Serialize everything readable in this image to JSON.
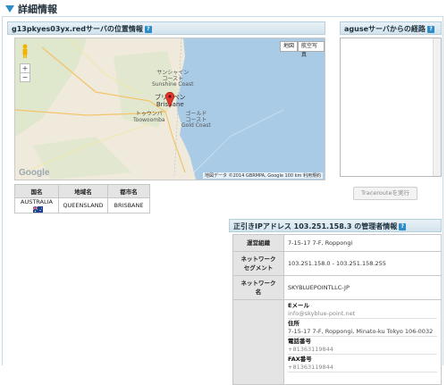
{
  "section": {
    "title": "詳細情報"
  },
  "location": {
    "panel_title": "g13pkyes03yx.redサーバの位置情報",
    "help": "?",
    "map": {
      "btn_map": "地図",
      "btn_sat": "航空写真",
      "zoom_in": "+",
      "zoom_out": "−",
      "google": "Google",
      "attribution": "地図データ ©2014 GBRMPA, Google  100 km  利用規約",
      "labels": {
        "sunshine_jp": "サンシャイン",
        "coast_jp": "コースト",
        "sunshine_en": "Sunshine Coast",
        "brisbane_jp": "ブリスベン",
        "brisbane_en": "Brisbane",
        "toowoomba_jp": "トゥウンバ",
        "toowoomba_en": "Toowoomba",
        "gold_jp": "ゴールド",
        "gold_coast_jp": "コースト",
        "gold_en": "Gold Coast"
      }
    },
    "table": {
      "headers": {
        "country": "国名",
        "region": "地域名",
        "city": "都市名"
      },
      "row": {
        "country": "AUSTRALIA",
        "region": "QUEENSLAND",
        "city": "BRISBANE"
      }
    }
  },
  "route": {
    "panel_title": "aguseサーバからの経路",
    "help": "?",
    "trace_button": "Tracerouteを実行"
  },
  "admin": {
    "panel_title": "正引きIPアドレス 103.251.158.3 の管理者情報",
    "help": "?",
    "rows": {
      "org": {
        "label": "運営組織",
        "value": "7-15-17 7-F, Roppongi"
      },
      "segment": {
        "label1": "ネットワーク",
        "label2": "セグメント",
        "value": "103.251.158.0 - 103.251.158.255"
      },
      "name": {
        "label1": "ネットワーク",
        "label2": "名",
        "value": "SKYBLUEPOINTLLC-JP"
      }
    },
    "contact": {
      "email_label": "Eメール",
      "email_value": "info@skyblue-point.net",
      "address_label": "住所",
      "address_value": "7-15-17 7-F, Roppongi, Minato-ku Tokyo 106-0032",
      "phone_label": "電話番号",
      "phone_value": "+81363119844",
      "fax_label": "FAX番号",
      "fax_value": "+81363119844"
    }
  }
}
